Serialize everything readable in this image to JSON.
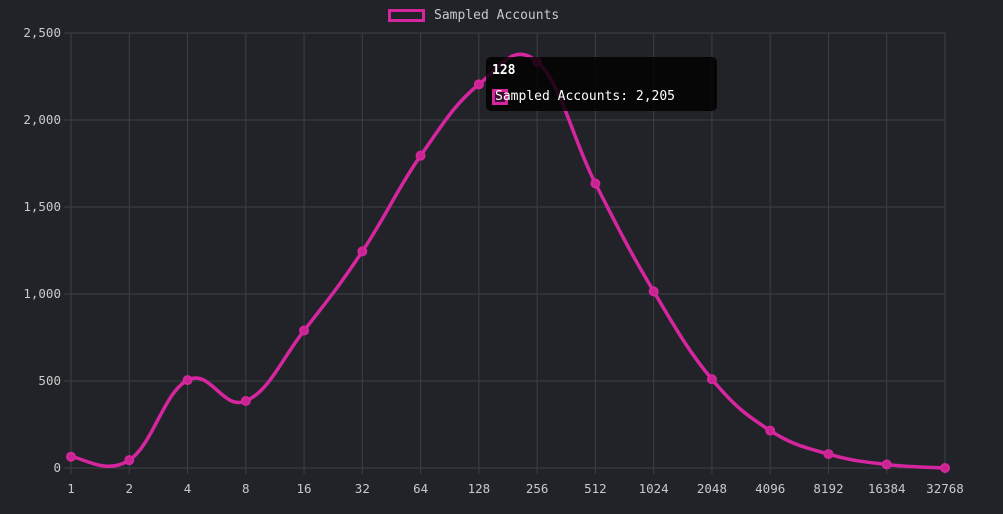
{
  "chart_data": {
    "type": "line",
    "categories": [
      "1",
      "2",
      "4",
      "8",
      "16",
      "32",
      "64",
      "128",
      "256",
      "512",
      "1024",
      "2048",
      "4096",
      "8192",
      "16384",
      "32768"
    ],
    "series": [
      {
        "name": "Sampled Accounts",
        "values": [
          65,
          45,
          505,
          385,
          790,
          1245,
          1795,
          2205,
          2335,
          1635,
          1015,
          510,
          215,
          80,
          20,
          0
        ]
      }
    ],
    "ylim": [
      0,
      2500
    ],
    "yticks": [
      0,
      500,
      1000,
      1500,
      2000,
      2500
    ],
    "ytick_labels": [
      "0",
      "500",
      "1,000",
      "1,500",
      "2,000",
      "2,500"
    ],
    "grid": true,
    "legend_position": "top-center",
    "colors": {
      "series": "#d6269f",
      "grid": "#3d4043",
      "axis_text": "#c9c9c9",
      "background": "#212328"
    }
  },
  "tooltip": {
    "title": "128",
    "label": "Sampled Accounts: 2,205"
  }
}
